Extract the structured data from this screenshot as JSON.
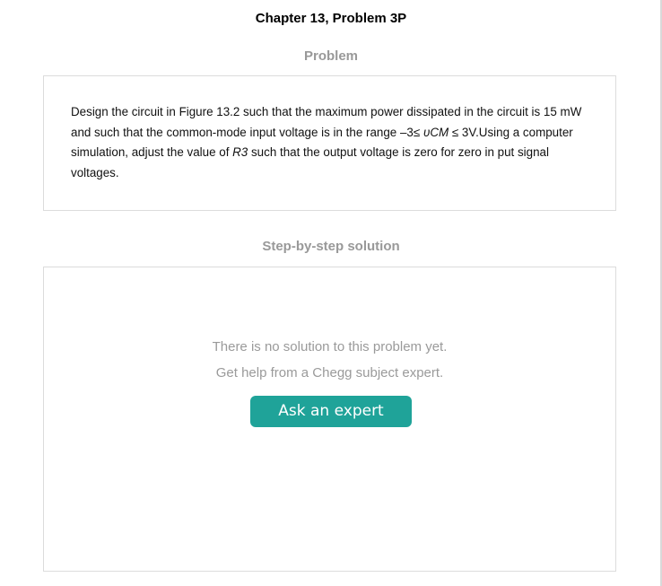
{
  "header": {
    "chapter_title": "Chapter 13, Problem 3P"
  },
  "problem": {
    "heading": "Problem",
    "text_parts": [
      "Design the circuit in Figure 13.2 such that the maximum power dissipated in the circuit is 15 mW and such that the common-mode input voltage is in the range –3≤ ",
      "υCM",
      " ≤ 3V.Using a computer simulation, adjust the value of ",
      "R3",
      " such that the output voltage is zero for zero in put signal voltages."
    ]
  },
  "solution": {
    "heading": "Step-by-step solution",
    "message_line1": "There is no solution to this problem yet.",
    "message_line2": "Get help from a Chegg subject expert.",
    "button_label": "Ask an expert"
  },
  "colors": {
    "button_accent": "#1fa399",
    "heading_gray": "#999999",
    "message_gray": "#9a9a9a"
  }
}
